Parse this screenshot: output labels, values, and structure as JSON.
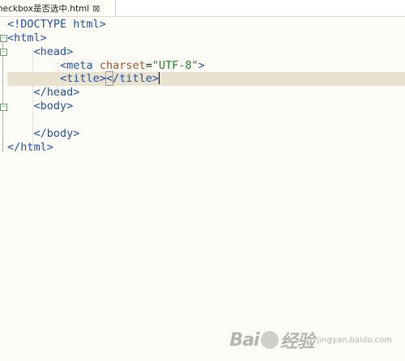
{
  "tab": {
    "title": "heckbox是否选中.html",
    "close_glyph": "⊠"
  },
  "code": {
    "l1": {
      "a": "<!DOCTYPE html>"
    },
    "l2": {
      "a": "<html>"
    },
    "l3": {
      "a": "<head>"
    },
    "l4": {
      "a": "<meta ",
      "attr": "charset",
      "eq": "=",
      "val": "\"UTF-8\"",
      "close": ">"
    },
    "l5": {
      "open": "<title>",
      "bracket": "<",
      "rest": "/title>"
    },
    "l6": {
      "a": "</head>"
    },
    "l7": {
      "a": "<body>"
    },
    "l8": {
      "a": ""
    },
    "l9": {
      "a": "</body>"
    },
    "l10": {
      "a": "</html>"
    }
  },
  "watermark": {
    "brand_left": "Bai",
    "brand_right": "经验",
    "sub": "jingyan.baidu.com"
  }
}
